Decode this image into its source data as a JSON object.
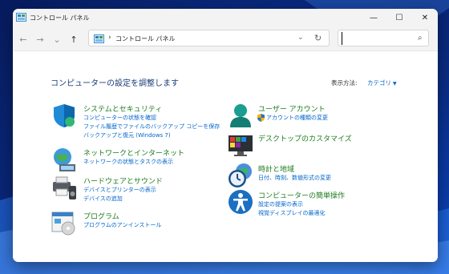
{
  "window": {
    "title": "コントロール パネル",
    "controls": {
      "minimize": "—",
      "maximize": "☐",
      "close": "✕"
    }
  },
  "nav": {
    "back": "←",
    "forward": "→",
    "recent": "⌄",
    "up": "↑",
    "address_chevron": "›",
    "breadcrumb": "コントロール パネル",
    "address_dropdown": "⌄",
    "refresh": "↻",
    "search_placeholder": "",
    "search_icon": "⌕"
  },
  "main": {
    "heading": "コンピューターの設定を調整します",
    "view_by_label": "表示方法:",
    "view_by_value": "カテゴリ",
    "view_by_arrow": "▼"
  },
  "categories": [
    {
      "icon": "shield-icon",
      "title": "システムとセキュリティ",
      "links": [
        "コンピューターの状態を確認",
        "ファイル履歴でファイルのバックアップ コピーを保存",
        "バックアップと復元 (Windows 7)"
      ]
    },
    {
      "icon": "network-icon",
      "title": "ネットワークとインターネット",
      "links": [
        "ネットワークの状態とタスクの表示"
      ]
    },
    {
      "icon": "printer-icon",
      "title": "ハードウェアとサウンド",
      "links": [
        "デバイスとプリンターの表示",
        "デバイスの追加"
      ]
    },
    {
      "icon": "programs-icon",
      "title": "プログラム",
      "links": [
        "プログラムのアンインストール"
      ]
    },
    {
      "icon": "user-icon",
      "title": "ユーザー アカウント",
      "links": [
        "アカウントの種類の変更"
      ]
    },
    {
      "icon": "desktop-icon",
      "title": "デスクトップのカスタマイズ",
      "links": []
    },
    {
      "icon": "clock-globe-icon",
      "title": "時計と地域",
      "links": [
        "日付、時刻、数値形式の変更"
      ]
    },
    {
      "icon": "accessibility-icon",
      "title": "コンピューターの簡単操作",
      "links": [
        "設定の提案の表示",
        "視覚ディスプレイの最適化"
      ]
    }
  ],
  "colors": {
    "category_title": "#1e7a1e",
    "link": "#0066cc",
    "heading": "#1a3e78"
  }
}
